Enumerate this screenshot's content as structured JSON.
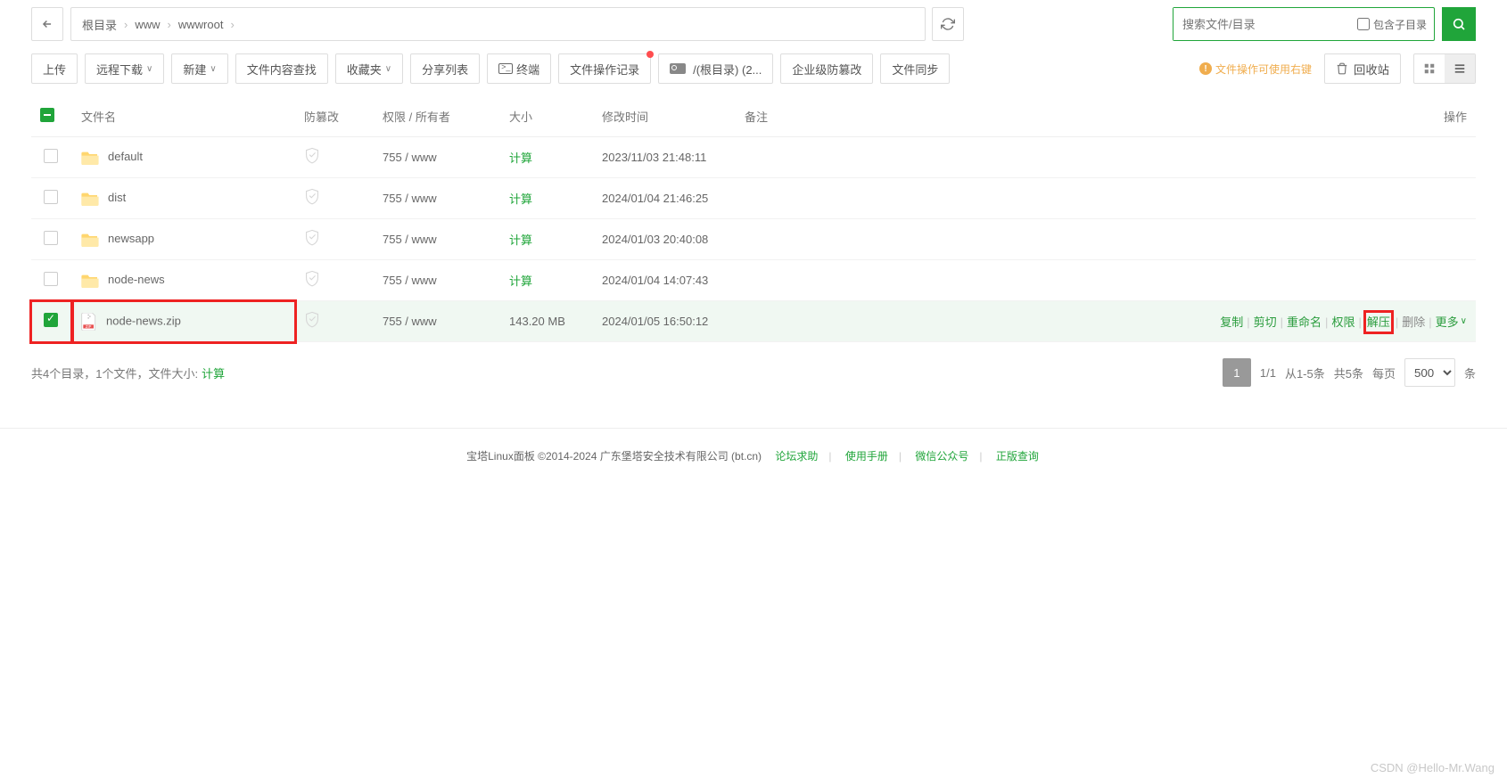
{
  "breadcrumb": [
    "根目录",
    "www",
    "wwwroot"
  ],
  "search": {
    "placeholder": "搜索文件/目录",
    "subdir_label": "包含子目录"
  },
  "toolbar": {
    "upload": "上传",
    "remote_download": "远程下载",
    "new": "新建",
    "content_search": "文件内容查找",
    "favorites": "收藏夹",
    "share_list": "分享列表",
    "terminal": "终端",
    "op_log": "文件操作记录",
    "disk": "/(根目录)  (2...",
    "enterprise": "企业级防篡改",
    "sync": "文件同步",
    "right_click_hint": "文件操作可使用右键",
    "recycle_bin": "回收站"
  },
  "columns": {
    "name": "文件名",
    "tamper": "防篡改",
    "perm": "权限 / 所有者",
    "size": "大小",
    "mtime": "修改时间",
    "remark": "备注",
    "action": "操作"
  },
  "rows": [
    {
      "selected": false,
      "type": "folder",
      "name": "default",
      "perm": "755 / www",
      "size": "计算",
      "mtime": "2023/11/03 21:48:11"
    },
    {
      "selected": false,
      "type": "folder",
      "name": "dist",
      "perm": "755 / www",
      "size": "计算",
      "mtime": "2024/01/04 21:46:25"
    },
    {
      "selected": false,
      "type": "folder",
      "name": "newsapp",
      "perm": "755 / www",
      "size": "计算",
      "mtime": "2024/01/03 20:40:08"
    },
    {
      "selected": false,
      "type": "folder",
      "name": "node-news",
      "perm": "755 / www",
      "size": "计算",
      "mtime": "2024/01/04 14:07:43"
    },
    {
      "selected": true,
      "type": "zip",
      "name": "node-news.zip",
      "perm": "755 / www",
      "size": "143.20 MB",
      "mtime": "2024/01/05 16:50:12"
    }
  ],
  "row_actions": {
    "copy": "复制",
    "cut": "剪切",
    "rename": "重命名",
    "perm": "权限",
    "unzip": "解压",
    "delete": "删除",
    "more": "更多"
  },
  "summary": {
    "text": "共4个目录，1个文件，文件大小: ",
    "calc": "计算"
  },
  "pagination": {
    "current": "1",
    "total": "1/1",
    "range": "从1-5条",
    "count": "共5条",
    "per_page": "每页",
    "size": "500",
    "unit": "条"
  },
  "footer": {
    "copyright": "宝塔Linux面板 ©2014-2024 广东堡塔安全技术有限公司 (bt.cn)",
    "forum": "论坛求助",
    "manual": "使用手册",
    "wechat": "微信公众号",
    "verify": "正版查询"
  },
  "watermark": "CSDN @Hello-Mr.Wang"
}
